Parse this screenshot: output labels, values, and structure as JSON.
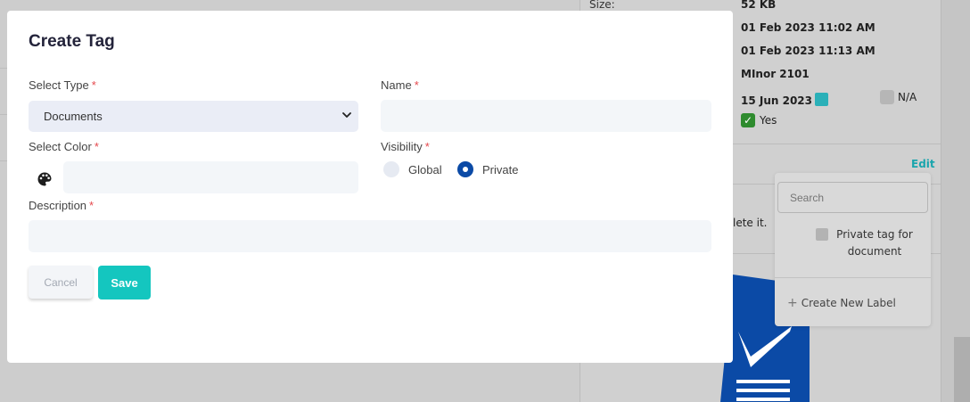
{
  "background": {
    "file_info": {
      "size_label": "Size:",
      "size_value": "52 KB",
      "created": "01 Feb 2023 11:02 AM",
      "modified": "01 Feb 2023 11:13 AM",
      "version": "MInor 2101",
      "expiry_date": "15 Jun 2023",
      "na_label": "N/A",
      "yes_label": "Yes"
    },
    "edit_label": "Edit",
    "delete_hint": "lete it."
  },
  "label_popover": {
    "search_placeholder": "Search",
    "private_tag_label": "Private tag for document",
    "create_new_label": "Create New Label"
  },
  "modal": {
    "title": "Create Tag",
    "select_type": {
      "label": "Select Type",
      "value": "Documents",
      "required_mark": "*"
    },
    "name": {
      "label": "Name",
      "value": "",
      "required_mark": "*"
    },
    "select_color": {
      "label": "Select Color",
      "value": "",
      "required_mark": "*"
    },
    "visibility": {
      "label": "Visibility",
      "required_mark": "*",
      "options": [
        "Global",
        "Private"
      ],
      "selected": "Private"
    },
    "description": {
      "label": "Description",
      "value": "",
      "required_mark": "*"
    },
    "cancel_label": "Cancel",
    "save_label": "Save"
  },
  "colors": {
    "accent": "#14c6bf",
    "radio_selected": "#0b4aa6",
    "required": "#e5484d"
  }
}
